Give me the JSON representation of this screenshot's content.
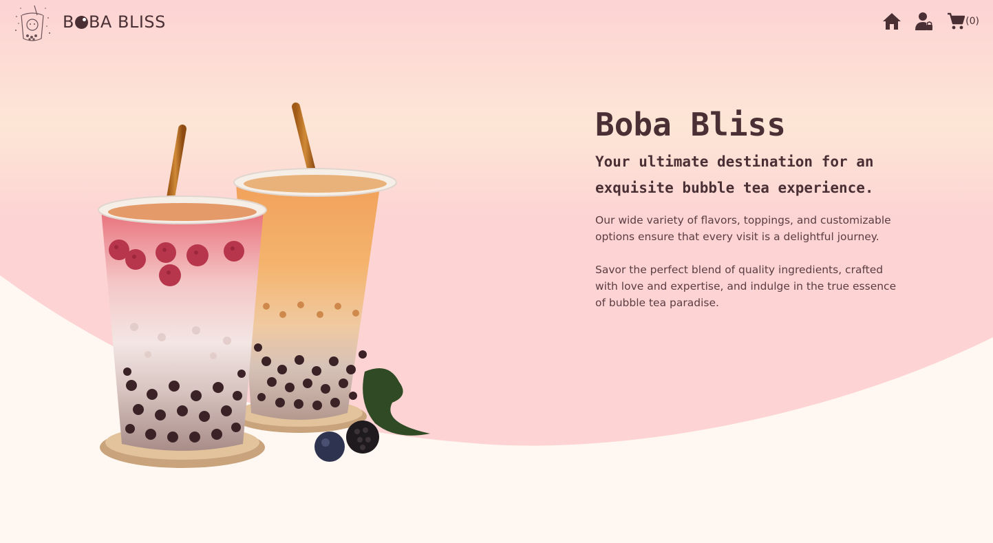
{
  "header": {
    "brand_prefix": "B",
    "brand_suffix": "BA BLISS",
    "cart_count": "(0)",
    "icons": {
      "home": "home-icon",
      "account": "user-lock-icon",
      "cart": "shopping-cart-icon",
      "logo": "boba-cup-logo-icon"
    }
  },
  "hero": {
    "title": "Boba Bliss",
    "subtitle": "Your ultimate destination for an exquisite bubble tea experience.",
    "paragraph_1": "Our wide variety of flavors, toppings, and customizable options ensure that every visit is a delightful journey.",
    "paragraph_2": "Savor the perfect blend of quality ingredients, crafted with love and expertise, and indulge in the true essence of bubble tea paradise."
  },
  "colors": {
    "background": "#fff8f2",
    "wave_pink": "#fdd3d4",
    "wave_peach": "#fde6d6",
    "text": "#4a3035"
  }
}
